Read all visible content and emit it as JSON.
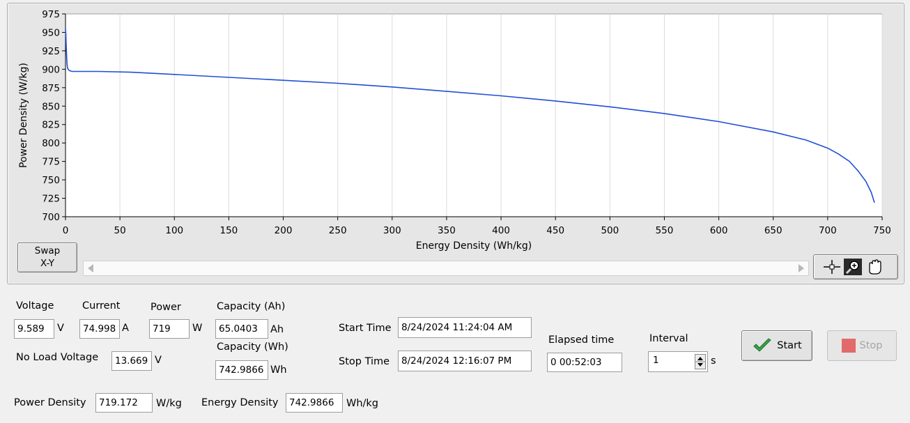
{
  "graph": {
    "x_axis_label": "Energy Density (Wh/kg)",
    "y_axis_label": "Power Density (W/kg)",
    "x_ticks": [
      "0",
      "50",
      "100",
      "150",
      "200",
      "250",
      "300",
      "350",
      "400",
      "450",
      "500",
      "550",
      "600",
      "650",
      "700",
      "750"
    ],
    "y_ticks": [
      "975",
      "950",
      "925",
      "900",
      "875",
      "850",
      "825",
      "800",
      "775",
      "750",
      "725",
      "700"
    ],
    "swap_button": {
      "line1": "Swap",
      "line2": "X-Y"
    },
    "tool_icons": [
      "crosshair-icon",
      "zoom-icon",
      "pan-hand-icon"
    ],
    "line_color": "#1f4fd6"
  },
  "chart_data": {
    "type": "line",
    "title": "",
    "xlabel": "Energy Density (Wh/kg)",
    "ylabel": "Power Density (W/kg)",
    "xlim": [
      0,
      750
    ],
    "ylim": [
      700,
      975
    ],
    "grid": true,
    "series": [
      {
        "x": [
          0,
          0.3,
          0.6,
          1,
          1.5,
          2,
          3,
          4,
          6,
          10,
          30,
          60,
          100,
          150,
          200,
          250,
          300,
          350,
          400,
          450,
          500,
          550,
          600,
          650,
          680,
          700,
          710,
          720,
          728,
          735,
          740,
          742.99
        ],
        "y": [
          955,
          948,
          935,
          918,
          906,
          901,
          899,
          898,
          897,
          897,
          897,
          896,
          893,
          889,
          885,
          881,
          876,
          870,
          864,
          857,
          849,
          840,
          829,
          815,
          804,
          793,
          785,
          775,
          762,
          748,
          733,
          719
        ]
      }
    ]
  },
  "readouts": {
    "voltage_label": "Voltage",
    "voltage_value": "9.589",
    "voltage_unit": "V",
    "current_label": "Current",
    "current_value": "74.998",
    "current_unit": "A",
    "power_label": "Power",
    "power_value": "719",
    "power_unit": "W",
    "capacity_ah_label": "Capacity (Ah)",
    "capacity_ah_value": "65.0403",
    "capacity_ah_unit": "Ah",
    "capacity_wh_label": "Capacity (Wh)",
    "capacity_wh_value": "742.9866",
    "capacity_wh_unit": "Wh",
    "no_load_voltage_label": "No Load Voltage",
    "no_load_voltage_value": "13.669",
    "no_load_voltage_unit": "V",
    "start_time_label": "Start Time",
    "start_time_value": "8/24/2024 11:24:04 AM",
    "stop_time_label": "Stop Time",
    "stop_time_value": "8/24/2024 12:16:07 PM",
    "elapsed_label": "Elapsed time",
    "elapsed_value": "0  00:52:03",
    "interval_label": "Interval",
    "interval_value": "1",
    "interval_unit": "s",
    "power_density_label": "Power Density",
    "power_density_value": "719.172",
    "power_density_unit": "W/kg",
    "energy_density_label": "Energy Density",
    "energy_density_value": "742.9866",
    "energy_density_unit": "Wh/kg"
  },
  "buttons": {
    "start_label": "Start",
    "stop_label": "Stop"
  },
  "colors": {
    "start_check": "#3aa14a",
    "stop_square": "#e26a6a"
  }
}
